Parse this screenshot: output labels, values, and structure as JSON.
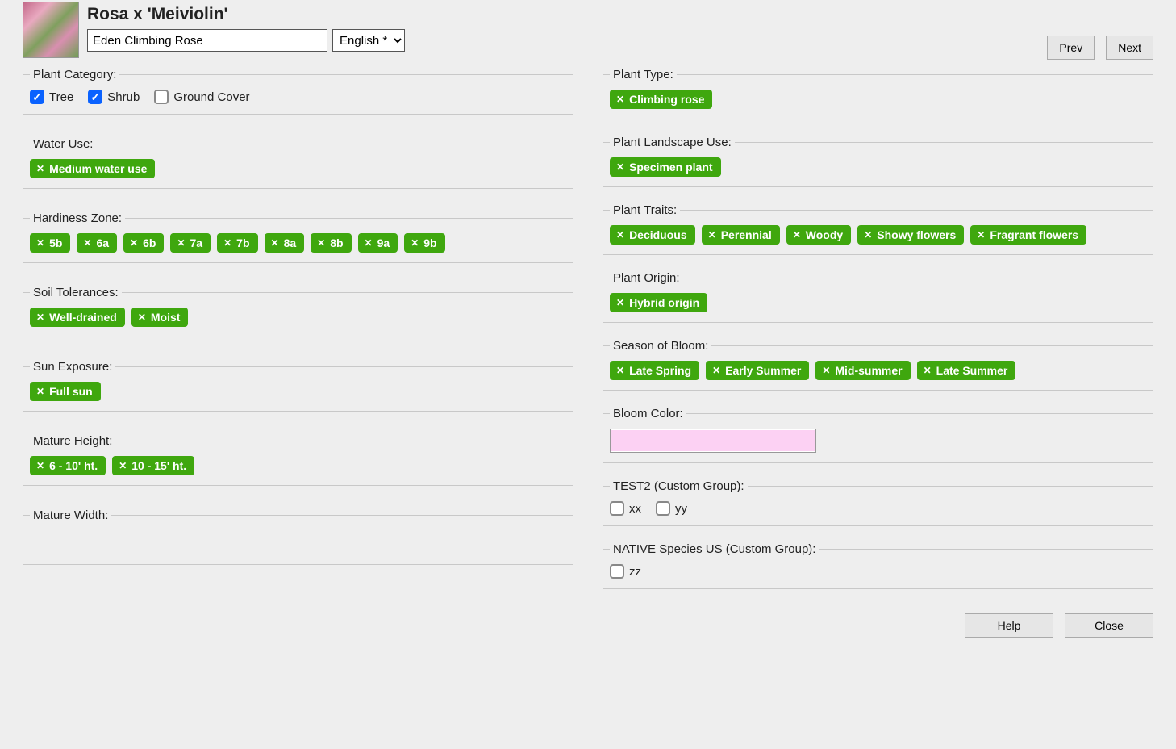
{
  "header": {
    "title": "Rosa x 'Meiviolin'",
    "common_name": "Eden Climbing Rose",
    "language": "English *",
    "prev": "Prev",
    "next": "Next"
  },
  "left": {
    "plant_category": {
      "legend": "Plant Category:",
      "options": [
        {
          "label": "Tree",
          "checked": true
        },
        {
          "label": "Shrub",
          "checked": true
        },
        {
          "label": "Ground Cover",
          "checked": false
        }
      ]
    },
    "water_use": {
      "legend": "Water Use:",
      "tags": [
        "Medium water use"
      ]
    },
    "hardiness_zone": {
      "legend": "Hardiness Zone:",
      "tags": [
        "5b",
        "6a",
        "6b",
        "7a",
        "7b",
        "8a",
        "8b",
        "9a",
        "9b"
      ]
    },
    "soil_tolerances": {
      "legend": "Soil Tolerances:",
      "tags": [
        "Well-drained",
        "Moist"
      ]
    },
    "sun_exposure": {
      "legend": "Sun Exposure:",
      "tags": [
        "Full sun"
      ]
    },
    "mature_height": {
      "legend": "Mature Height:",
      "tags": [
        "6 - 10' ht.",
        "10 - 15' ht."
      ]
    },
    "mature_width": {
      "legend": "Mature Width:",
      "tags": []
    }
  },
  "right": {
    "plant_type": {
      "legend": "Plant Type:",
      "tags": [
        "Climbing rose"
      ]
    },
    "plant_landscape_use": {
      "legend": "Plant Landscape Use:",
      "tags": [
        "Specimen plant"
      ]
    },
    "plant_traits": {
      "legend": "Plant Traits:",
      "tags": [
        "Deciduous",
        "Perennial",
        "Woody",
        "Showy flowers",
        "Fragrant flowers"
      ]
    },
    "plant_origin": {
      "legend": "Plant Origin:",
      "tags": [
        "Hybrid origin"
      ]
    },
    "season_of_bloom": {
      "legend": "Season of Bloom:",
      "tags": [
        "Late Spring",
        "Early Summer",
        "Mid-summer",
        "Late Summer"
      ]
    },
    "bloom_color": {
      "legend": "Bloom Color:",
      "color": "#fcd1f3"
    },
    "test2": {
      "legend": "TEST2 (Custom Group):",
      "options": [
        {
          "label": "xx",
          "checked": false
        },
        {
          "label": "yy",
          "checked": false
        }
      ]
    },
    "native_species": {
      "legend": "NATIVE Species US (Custom Group):",
      "options": [
        {
          "label": "zz",
          "checked": false
        }
      ]
    }
  },
  "footer": {
    "help": "Help",
    "close": "Close"
  }
}
